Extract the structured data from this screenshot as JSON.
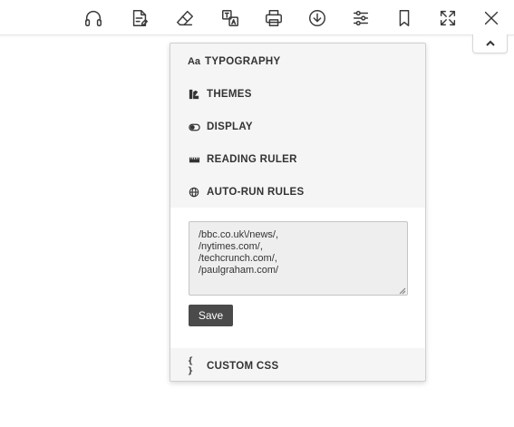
{
  "toolbar": {
    "icons": [
      {
        "name": "headphones-icon"
      },
      {
        "name": "edit-document-icon"
      },
      {
        "name": "eraser-icon"
      },
      {
        "name": "translate-icon"
      },
      {
        "name": "print-icon"
      },
      {
        "name": "download-icon"
      },
      {
        "name": "sliders-icon"
      },
      {
        "name": "bookmark-icon"
      },
      {
        "name": "fullscreen-icon"
      },
      {
        "name": "close-icon"
      }
    ]
  },
  "settings_menu": {
    "items": [
      {
        "icon_text": "Aa",
        "label": "TYPOGRAPHY"
      },
      {
        "label": "THEMES"
      },
      {
        "label": "DISPLAY"
      },
      {
        "label": "READING RULER"
      },
      {
        "label": "AUTO-RUN RULES"
      }
    ],
    "auto_run": {
      "rules_value": "/bbc.co.uk\\/news/,\n/nytimes.com/,\n/techcrunch.com/,\n/paulgraham.com/",
      "save_label": "Save"
    },
    "custom_css": {
      "icon_text": "{ }",
      "label": "CUSTOM CSS"
    }
  },
  "colors": {
    "panel_bg": "#f5f5f5",
    "save_bg": "#4a4a4a",
    "textarea_bg": "#eeeeee"
  }
}
